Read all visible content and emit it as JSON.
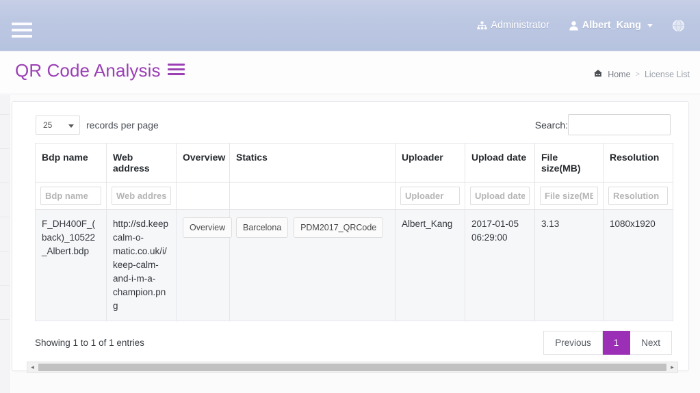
{
  "topbar": {
    "menu_icon": "hamburger-icon",
    "items": [
      {
        "label": "Administrator",
        "icon": "sitemap-icon"
      },
      {
        "label": "Albert_Kang",
        "icon": "user-icon",
        "caret": true
      },
      {
        "label": "",
        "icon": "globe-icon"
      }
    ]
  },
  "page": {
    "title": "QR Code Analysis",
    "title_icon": "bars-icon",
    "breadcrumb": {
      "home_icon": "home-icon",
      "home": "Home",
      "separator": ">",
      "current": "License List"
    }
  },
  "toolbar": {
    "page_length_value": "25",
    "page_length_options": [
      "25"
    ],
    "records_per_page_label": "records per page",
    "search_label": "Search:",
    "search_value": "",
    "search_placeholder": ""
  },
  "table": {
    "columns": [
      "Bdp name",
      "Web address",
      "Overview",
      "Statics",
      "Uploader",
      "Upload date",
      "File size(MB)",
      "Resolution"
    ],
    "filters": [
      {
        "placeholder": "Bdp name",
        "value": ""
      },
      {
        "placeholder": "Web address",
        "value": ""
      },
      {
        "placeholder": "",
        "value": ""
      },
      {
        "placeholder": "",
        "value": ""
      },
      {
        "placeholder": "Uploader",
        "value": ""
      },
      {
        "placeholder": "Upload date",
        "value": ""
      },
      {
        "placeholder": "File size(MB)",
        "value": ""
      },
      {
        "placeholder": "Resolution",
        "value": ""
      }
    ],
    "rows": [
      {
        "bdp_name": "F_DH400F_(back)_10522_Albert.bdp",
        "web_address": "http://sd.keepcalm-o-matic.co.uk/i/keep-calm-and-i-m-a-champion.png",
        "overview_button": "Overview",
        "statics_tags": [
          "Barcelona",
          "PDM2017_QRCode"
        ],
        "uploader": "Albert_Kang",
        "upload_date": "2017-01-05 06:29:00",
        "file_size": "3.13",
        "resolution": "1080x1920"
      }
    ]
  },
  "footer": {
    "info": "Showing 1 to 1 of 1 entries",
    "pagination": {
      "previous": "Previous",
      "pages": [
        "1"
      ],
      "active_page": "1",
      "next": "Next"
    }
  },
  "scrollbar": {
    "left_arrow": "◂",
    "right_arrow": "▸"
  },
  "colors": {
    "accent_purple": "#9b2fb5",
    "title_purple": "#9b3fb5",
    "topbar_gradient_start": "#c6cfe6",
    "topbar_gradient_end": "#b6c3e0",
    "row_background": "#f6f7f9"
  }
}
